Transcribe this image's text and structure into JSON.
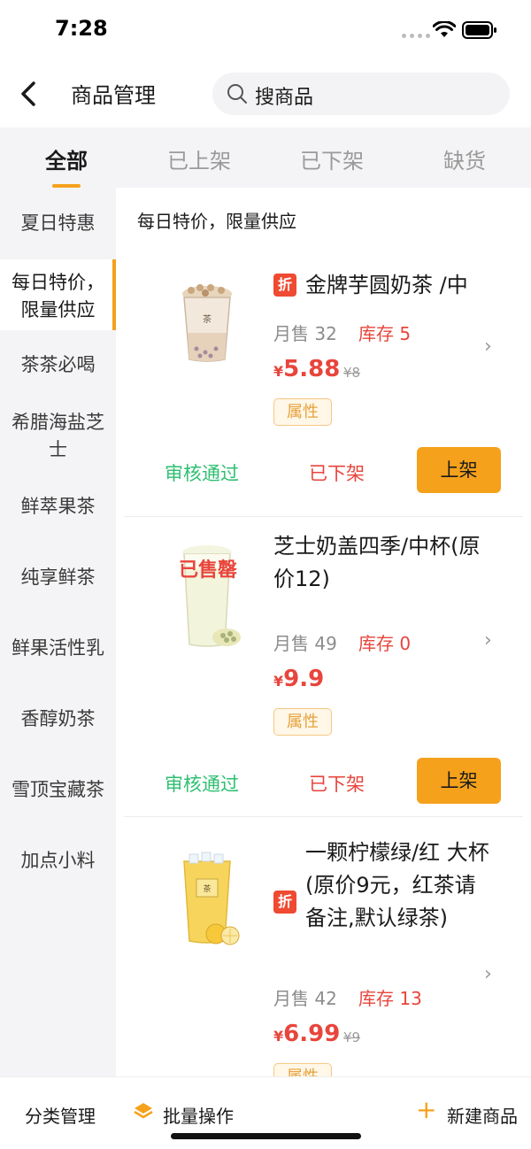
{
  "status": {
    "time": "7:28"
  },
  "header": {
    "title": "商品管理",
    "search_placeholder": "搜商品"
  },
  "tabs": [
    {
      "label": "全部"
    },
    {
      "label": "已上架"
    },
    {
      "label": "已下架"
    },
    {
      "label": "缺货"
    }
  ],
  "sidebar": {
    "items": [
      {
        "label": "夏日特惠"
      },
      {
        "label": "每日特价，限量供应"
      },
      {
        "label": "茶茶必喝"
      },
      {
        "label": "希腊海盐芝士"
      },
      {
        "label": "鲜萃果茶"
      },
      {
        "label": "纯享鲜茶"
      },
      {
        "label": "鲜果活性乳"
      },
      {
        "label": "香醇奶茶"
      },
      {
        "label": "雪顶宝藏茶"
      },
      {
        "label": "加点小料"
      }
    ]
  },
  "section": {
    "title": "每日特价，限量供应"
  },
  "products": [
    {
      "badge": "折",
      "name": "金牌芋圆奶茶 /中",
      "sales": "月售 32",
      "stock": "库存 5",
      "yen": "¥",
      "price": "5.88",
      "orig_price": "¥8",
      "attr": "属性",
      "review_status": "审核通过",
      "shelf_status": "已下架",
      "action": "上架"
    },
    {
      "sold_out": "已售罄",
      "name": "芝士奶盖四季/中杯(原价12)",
      "sales": "月售 49",
      "stock": "库存 0",
      "yen": "¥",
      "price": "9.9",
      "attr": "属性",
      "review_status": "审核通过",
      "shelf_status": "已下架",
      "action": "上架"
    },
    {
      "badge": "折",
      "name": "一颗柠檬绿/红 大杯 (原价9元，红茶请备注,默认绿茶)",
      "sales": "月售 42",
      "stock": "库存 13",
      "yen": "¥",
      "price": "6.99",
      "orig_price": "¥9",
      "attr": "属性"
    }
  ],
  "bottom_bar": {
    "category_manage": "分类管理",
    "batch_ops": "批量操作",
    "plus": "+",
    "new_product": "新建商品"
  },
  "colors": {
    "accent": "#f5a11c",
    "price_red": "#e8453c",
    "approved_green": "#2fbf71",
    "badge_red": "#ef4a32"
  },
  "icons": [
    "back-arrow-icon",
    "search-icon",
    "chevron-right-icon",
    "layers-icon",
    "plus-icon",
    "wifi-icon",
    "battery-icon"
  ]
}
